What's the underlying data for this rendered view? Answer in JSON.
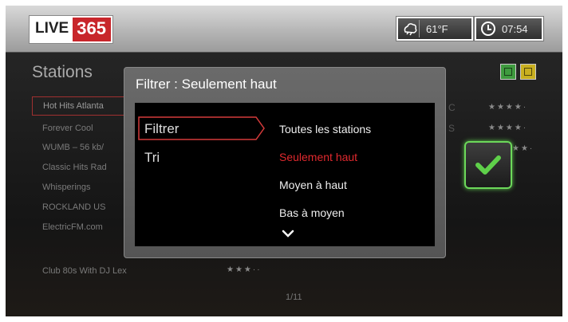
{
  "header": {
    "logo_live": "LIVE",
    "logo_num": "365",
    "temperature": "61°F",
    "time": "07:54"
  },
  "list": {
    "title": "Stations",
    "page": "1/11",
    "stations": [
      {
        "name": "Hot Hits Atlanta",
        "selected": true
      },
      {
        "name": "Forever Cool",
        "selected": false
      },
      {
        "name": "WUMB – 56 kb/",
        "selected": false
      },
      {
        "name": "Classic Hits Rad",
        "selected": false
      },
      {
        "name": "Whisperings",
        "selected": false
      },
      {
        "name": "ROCKLAND US",
        "selected": false
      },
      {
        "name": "ElectricFM.com",
        "selected": false
      },
      {
        "name": "Club 80s With DJ Lex",
        "selected": false
      }
    ],
    "ratings": [
      {
        "stars": "★★★★·"
      },
      {
        "stars": "★★★★·"
      },
      {
        "stars": "★★·"
      },
      {
        "stars": "★★★··"
      }
    ],
    "partial_letters": [
      "C",
      "S"
    ]
  },
  "dialog": {
    "title": "Filtrer : Seulement haut",
    "menu": [
      "Filtrer",
      "Tri"
    ],
    "options": [
      "Toutes les stations",
      "Seulement haut",
      "Moyen à haut",
      "Bas à moyen"
    ],
    "active_option": "Seulement haut"
  },
  "colors": {
    "accent_red": "#e0292e",
    "check_green": "#6cd85a"
  },
  "icons": [
    "weather-icon",
    "clock-icon",
    "check-icon",
    "chevron-down-icon",
    "green-button-icon",
    "yellow-button-icon"
  ]
}
